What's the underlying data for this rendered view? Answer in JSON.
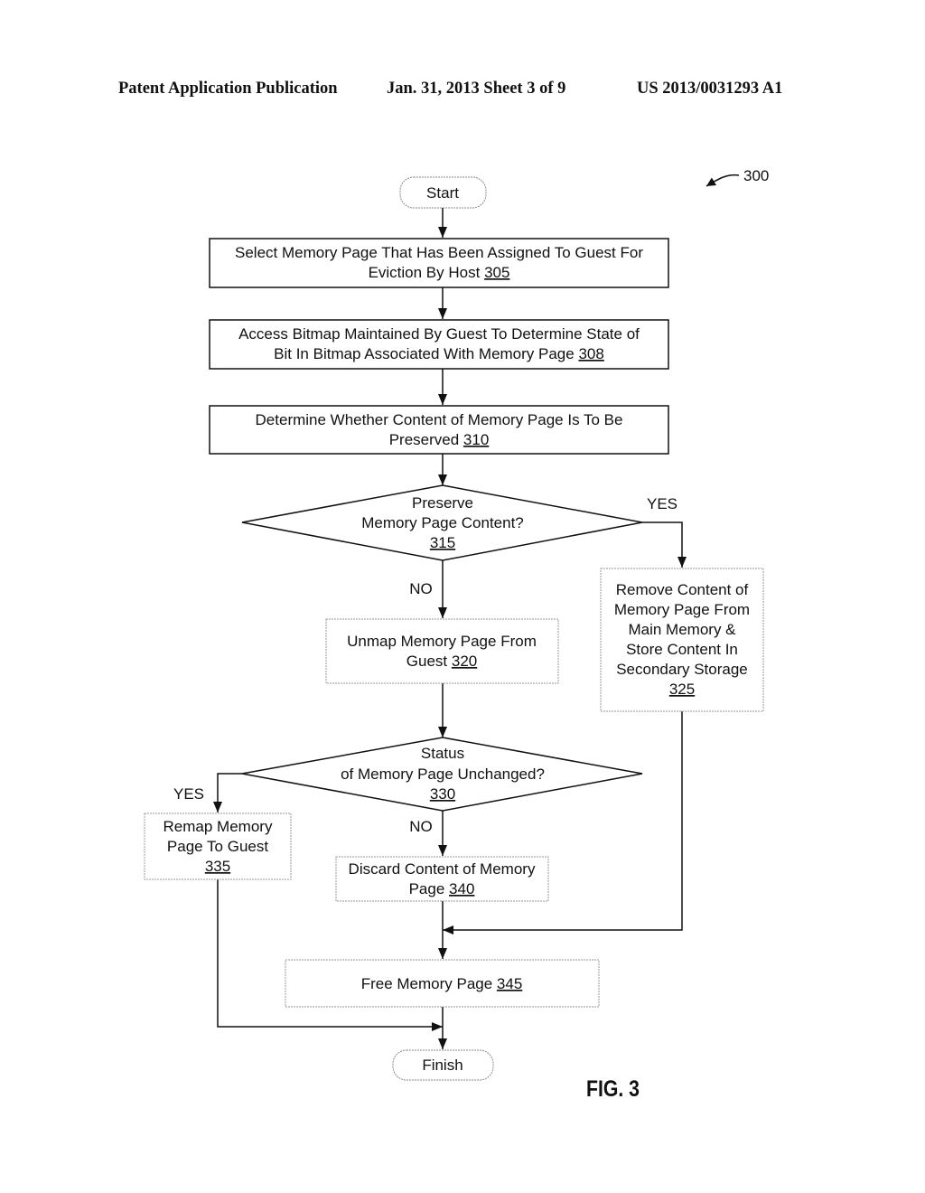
{
  "header": {
    "publication": "Patent Application Publication",
    "date_sheet": "Jan. 31, 2013  Sheet 3 of 9",
    "patent_number": "US 2013/0031293 A1"
  },
  "figure": {
    "ref_number": "300",
    "label": "FIG. 3"
  },
  "nodes": {
    "start": {
      "text": "Start"
    },
    "n305": {
      "lines": [
        "Select Memory Page That Has Been Assigned To Guest For",
        "Eviction By Host"
      ],
      "ref": "305"
    },
    "n308": {
      "lines": [
        "Access Bitmap Maintained By Guest To Determine State of",
        "Bit In Bitmap Associated With Memory Page"
      ],
      "ref": "308"
    },
    "n310": {
      "lines": [
        "Determine Whether Content of Memory Page Is To Be",
        "Preserved"
      ],
      "ref": "310"
    },
    "n315": {
      "lines": [
        "Preserve",
        "Memory Page Content?"
      ],
      "ref": "315"
    },
    "n320": {
      "lines": [
        "Unmap Memory Page From",
        "Guest"
      ],
      "ref": "320"
    },
    "n325": {
      "lines": [
        "Remove Content of",
        "Memory Page From",
        "Main Memory &",
        "Store Content In",
        "Secondary Storage"
      ],
      "ref": "325"
    },
    "n330": {
      "lines": [
        "Status",
        "of Memory Page Unchanged?"
      ],
      "ref": "330"
    },
    "n335": {
      "lines": [
        "Remap Memory",
        "Page To Guest"
      ],
      "ref": "335"
    },
    "n340": {
      "lines": [
        "Discard Content of Memory",
        "Page"
      ],
      "ref": "340"
    },
    "n345": {
      "lines": [
        "Free Memory Page"
      ],
      "ref": "345"
    },
    "finish": {
      "text": "Finish"
    }
  },
  "edge_labels": {
    "yes_315": "YES",
    "no_315": "NO",
    "yes_330": "YES",
    "no_330": "NO"
  }
}
